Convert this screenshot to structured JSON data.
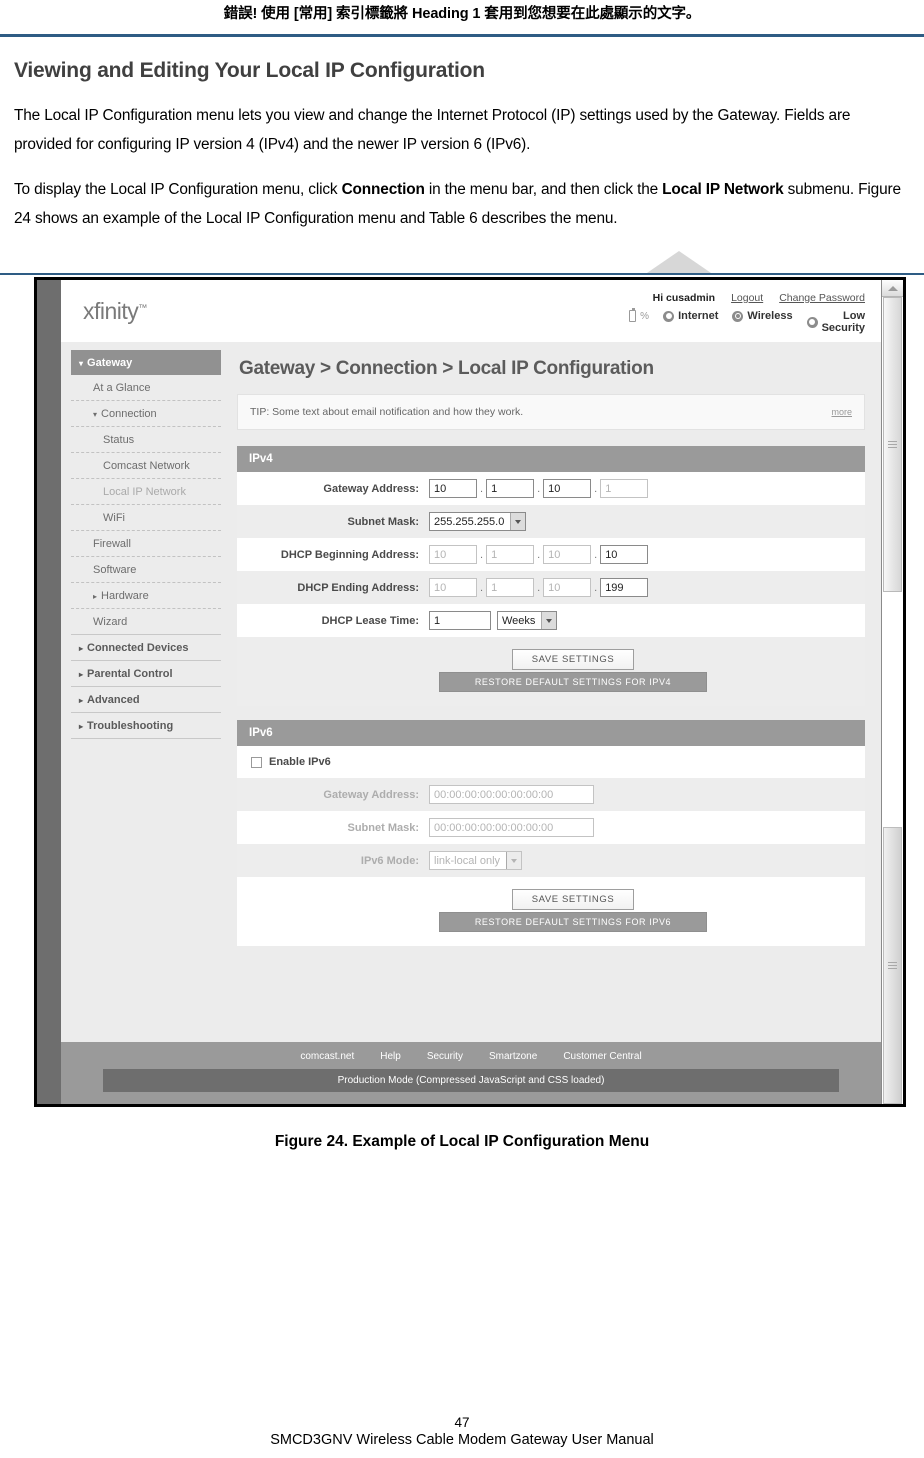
{
  "document": {
    "header_note": "錯誤! 使用 [常用] 索引標籤將 Heading 1 套用到您想要在此處顯示的文字。",
    "section_title": "Viewing and Editing Your Local IP Configuration",
    "paragraph_1": "The Local IP Configuration menu lets you view and change the Internet Protocol (IP) settings used by the Gateway. Fields are provided for configuring IP version 4 (IPv4) and the newer IP version 6 (IPv6).",
    "paragraph_2_a": "To display the Local IP Configuration menu, click ",
    "paragraph_2_b": "Connection",
    "paragraph_2_c": " in the menu bar, and then click the ",
    "paragraph_2_d": "Local IP Network",
    "paragraph_2_e": " submenu. Figure 24 shows an example of the Local IP Configuration menu and Table 6 describes the menu.",
    "figure_caption": "Figure 24. Example of Local IP Configuration Menu",
    "page_number": "47",
    "manual_title": "SMCD3GNV Wireless Cable Modem Gateway User Manual",
    "rule_color": "#2e5c84"
  },
  "gateway_ui": {
    "logo": "xfinity",
    "logo_mark": "™",
    "account": {
      "greeting": "Hi cusadmin",
      "logout": "Logout",
      "change_password": "Change Password"
    },
    "status": {
      "battery_percent": "%",
      "internet": "Internet",
      "wireless": "Wireless",
      "security_line1": "Low",
      "security_line2": "Security"
    },
    "sidebar": [
      {
        "label": "Gateway",
        "level": "top",
        "state": "active-head",
        "caret": "down"
      },
      {
        "label": "At a Glance",
        "level": "lvl2",
        "state": "normal",
        "caret": "none"
      },
      {
        "label": "Connection",
        "level": "lvl2",
        "state": "normal",
        "caret": "down"
      },
      {
        "label": "Status",
        "level": "lvl3",
        "state": "normal",
        "caret": "none"
      },
      {
        "label": "Comcast Network",
        "level": "lvl3",
        "state": "normal",
        "caret": "none"
      },
      {
        "label": "Local IP Network",
        "level": "lvl3",
        "state": "current",
        "caret": "none"
      },
      {
        "label": "WiFi",
        "level": "lvl3",
        "state": "normal",
        "caret": "none"
      },
      {
        "label": "Firewall",
        "level": "lvl2",
        "state": "normal",
        "caret": "none"
      },
      {
        "label": "Software",
        "level": "lvl2",
        "state": "normal",
        "caret": "none"
      },
      {
        "label": "Hardware",
        "level": "lvl2",
        "state": "normal",
        "caret": "right"
      },
      {
        "label": "Wizard",
        "level": "lvl2",
        "state": "normal",
        "caret": "none"
      },
      {
        "label": "Connected Devices",
        "level": "top",
        "state": "normal",
        "caret": "right"
      },
      {
        "label": "Parental Control",
        "level": "top",
        "state": "normal",
        "caret": "right"
      },
      {
        "label": "Advanced",
        "level": "top",
        "state": "normal",
        "caret": "right"
      },
      {
        "label": "Troubleshooting",
        "level": "top",
        "state": "normal",
        "caret": "right"
      }
    ],
    "page_title": "Gateway > Connection > Local IP Configuration",
    "tip": {
      "text": "TIP: Some text about email notification and how they work.",
      "more_label": "more"
    },
    "ipv4": {
      "panel_title": "IPv4",
      "gateway_address": {
        "label": "Gateway Address:",
        "octets": [
          "10",
          "1",
          "10",
          "1"
        ],
        "octet_disabled": [
          false,
          false,
          false,
          true
        ]
      },
      "subnet_mask": {
        "label": "Subnet Mask:",
        "value": "255.255.255.0"
      },
      "dhcp_beginning": {
        "label": "DHCP Beginning Address:",
        "octets": [
          "10",
          "1",
          "10",
          "10"
        ],
        "octet_disabled": [
          true,
          true,
          true,
          false
        ]
      },
      "dhcp_ending": {
        "label": "DHCP Ending Address:",
        "octets": [
          "10",
          "1",
          "10",
          "199"
        ],
        "octet_disabled": [
          true,
          true,
          true,
          false
        ]
      },
      "dhcp_lease_time": {
        "label": "DHCP Lease Time:",
        "value": "1",
        "unit": "Weeks"
      },
      "save_label": "SAVE SETTINGS",
      "restore_label": "RESTORE DEFAULT SETTINGS FOR IPV4"
    },
    "ipv6": {
      "panel_title": "IPv6",
      "enable_label": "Enable IPv6",
      "enabled": false,
      "gateway_address": {
        "label": "Gateway Address:",
        "value": "00:00:00:00:00:00:00:00"
      },
      "subnet_mask": {
        "label": "Subnet Mask:",
        "value": "00:00:00:00:00:00:00:00"
      },
      "ipv6_mode": {
        "label": "IPv6 Mode:",
        "value": "link-local only"
      },
      "save_label": "SAVE SETTINGS",
      "restore_label": "RESTORE DEFAULT SETTINGS FOR IPV6"
    },
    "footer": {
      "links": [
        "comcast.net",
        "Help",
        "Security",
        "Smartzone",
        "Customer Central"
      ],
      "production_mode": "Production Mode (Compressed JavaScript and CSS loaded)"
    }
  }
}
